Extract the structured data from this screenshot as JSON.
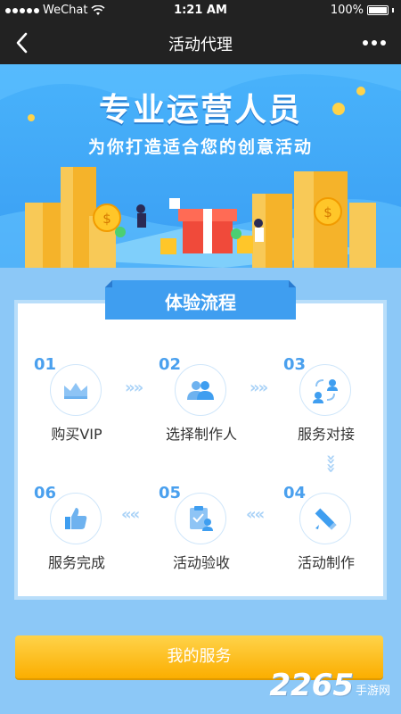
{
  "status_bar": {
    "carrier": "WeChat",
    "time": "1:21 AM",
    "battery": "100%"
  },
  "nav": {
    "title": "活动代理"
  },
  "banner": {
    "title": "专业运营人员",
    "subtitle": "为你打造适合您的创意活动"
  },
  "section": {
    "title": "体验流程"
  },
  "steps": [
    {
      "num": "01",
      "label": "购买VIP",
      "icon": "crown-icon"
    },
    {
      "num": "02",
      "label": "选择制作人",
      "icon": "people-icon"
    },
    {
      "num": "03",
      "label": "服务对接",
      "icon": "exchange-icon"
    },
    {
      "num": "04",
      "label": "活动制作",
      "icon": "pencil-ruler-icon"
    },
    {
      "num": "05",
      "label": "活动验收",
      "icon": "clipboard-user-icon"
    },
    {
      "num": "06",
      "label": "服务完成",
      "icon": "thumbs-up-icon"
    }
  ],
  "service_button": {
    "label": "我的服务"
  },
  "watermark": {
    "number": "2265",
    "text": "手游网"
  },
  "colors": {
    "accent_blue": "#4aa0ee",
    "button_yellow": "#fbae00",
    "page_bg": "#8cc8f7"
  }
}
